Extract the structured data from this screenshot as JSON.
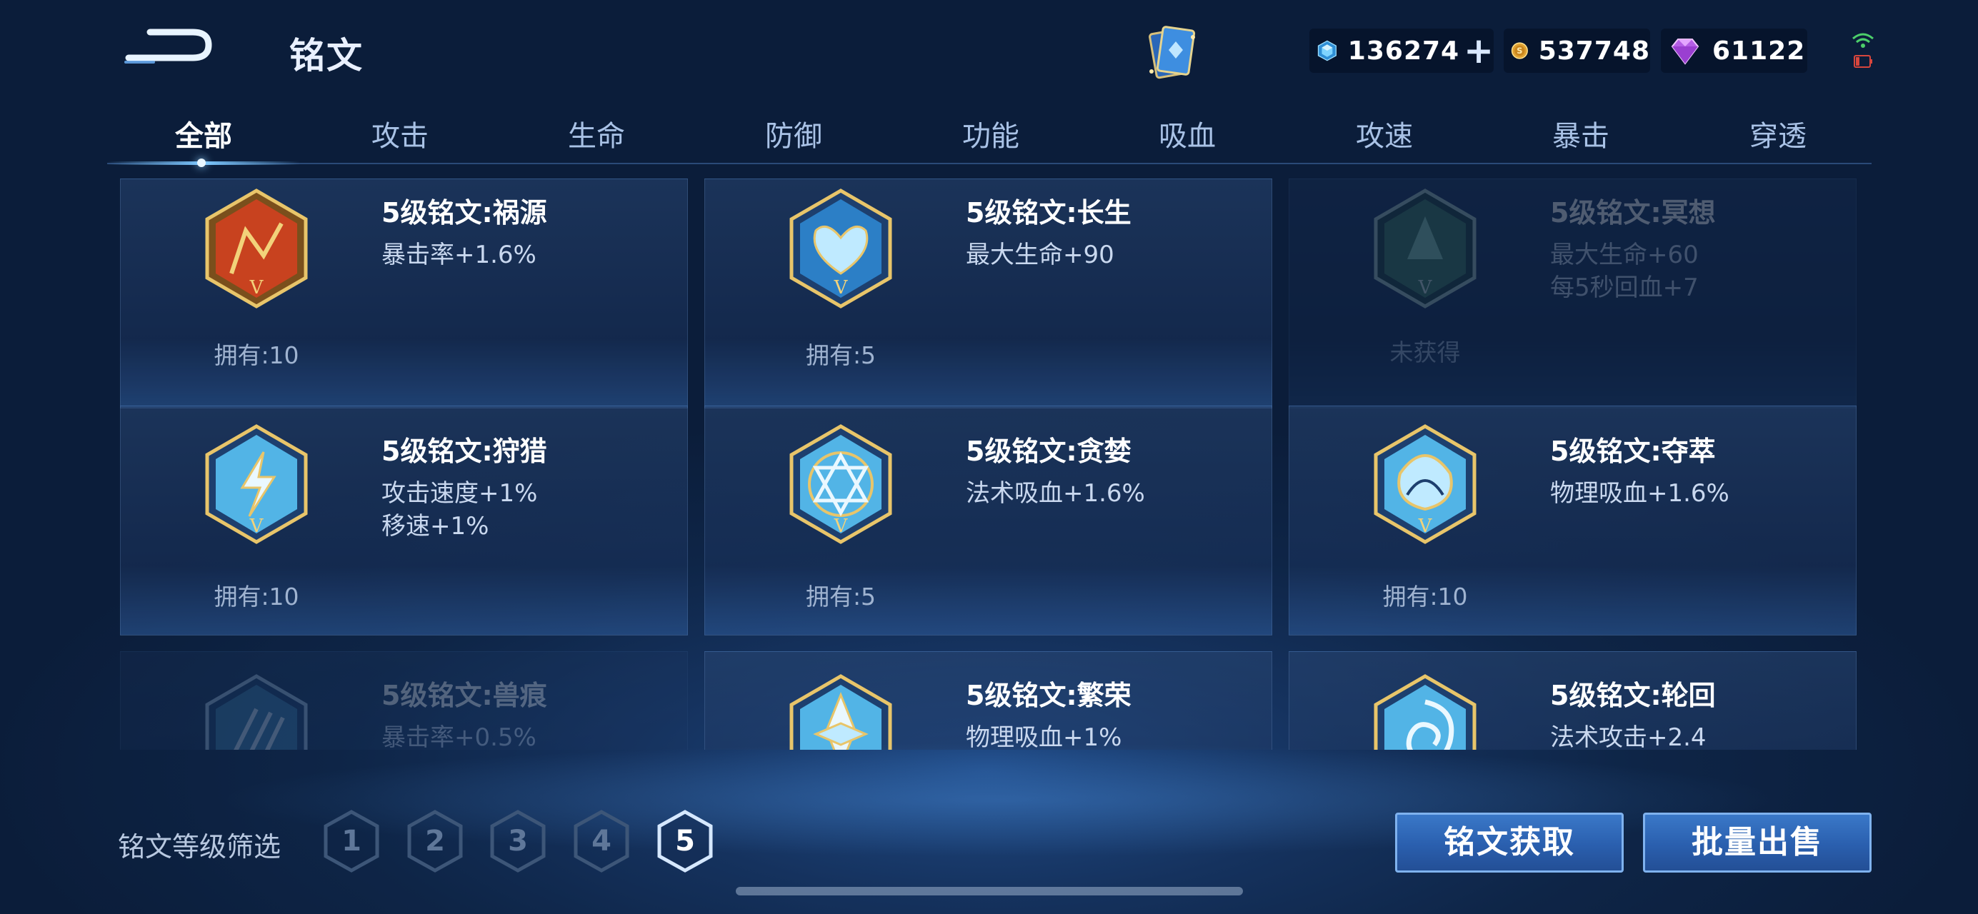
{
  "header": {
    "title": "铭文",
    "currencies": [
      {
        "icon": "diamond-icon",
        "value": "136274"
      },
      {
        "icon": "gold-coin-icon",
        "value": "537748"
      },
      {
        "icon": "gem-icon",
        "value": "61122"
      }
    ],
    "plus_label": "+"
  },
  "tabs": [
    {
      "label": "全部",
      "active": true
    },
    {
      "label": "攻击"
    },
    {
      "label": "生命"
    },
    {
      "label": "防御"
    },
    {
      "label": "功能"
    },
    {
      "label": "吸血"
    },
    {
      "label": "攻速"
    },
    {
      "label": "暴击"
    },
    {
      "label": "穿透"
    }
  ],
  "cards": [
    {
      "name": "5级铭文:祸源",
      "attrs": [
        "暴击率+1.6%"
      ],
      "owned": "拥有:10",
      "icon": "red-crack-emblem-icon",
      "color": "#c8421f"
    },
    {
      "name": "5级铭文:长生",
      "attrs": [
        "最大生命+90"
      ],
      "owned": "拥有:5",
      "icon": "blue-heart-emblem-icon",
      "color": "#2c7fc6"
    },
    {
      "name": "5级铭文:冥想",
      "attrs": [
        "最大生命+60",
        "每5秒回血+7"
      ],
      "owned": "未获得",
      "icon": "green-tree-emblem-icon",
      "color": "#3f7b5e",
      "dim": true
    },
    {
      "name": "5级铭文:狩猎",
      "attrs": [
        "攻击速度+1%",
        "移速+1%"
      ],
      "owned": "拥有:10",
      "icon": "blue-lightning-emblem-icon",
      "color": "#2c7fc6"
    },
    {
      "name": "5级铭文:贪婪",
      "attrs": [
        "法术吸血+1.6%"
      ],
      "owned": "拥有:5",
      "icon": "blue-triangle-emblem-icon",
      "color": "#2c7fc6"
    },
    {
      "name": "5级铭文:夺萃",
      "attrs": [
        "物理吸血+1.6%"
      ],
      "owned": "拥有:10",
      "icon": "blue-knot-emblem-icon",
      "color": "#2c7fc6"
    },
    {
      "name": "5级铭文:兽痕",
      "attrs": [
        "暴击率+0.5%"
      ],
      "owned": "",
      "icon": "blue-claw-emblem-icon",
      "color": "#2c7fc6",
      "dim": true
    },
    {
      "name": "5级铭文:繁荣",
      "attrs": [
        "物理吸血+1%"
      ],
      "owned": "",
      "icon": "blue-crystal-emblem-icon",
      "color": "#2c7fc6"
    },
    {
      "name": "5级铭文:轮回",
      "attrs": [
        "法术攻击+2.4"
      ],
      "owned": "",
      "icon": "blue-swirl-emblem-icon",
      "color": "#2c7fc6"
    }
  ],
  "filter": {
    "label": "铭文等级筛选",
    "levels": [
      "1",
      "2",
      "3",
      "4",
      "5"
    ],
    "selected": "5"
  },
  "buttons": {
    "acquire": "铭文获取",
    "bulk_sell": "批量出售"
  }
}
